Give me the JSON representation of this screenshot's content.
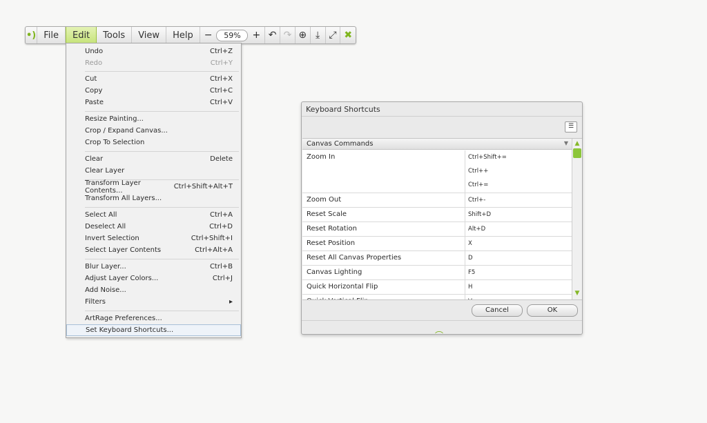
{
  "toolbar": {
    "menus": [
      "File",
      "Edit",
      "Tools",
      "View",
      "Help"
    ],
    "zoom_value": "59%",
    "zoom_minus": "−",
    "zoom_plus": "+",
    "icons": [
      "app-logo-icon",
      "undo-icon",
      "redo-icon",
      "add-canvas-icon",
      "download-icon",
      "fullscreen-icon",
      "close-icon"
    ]
  },
  "edit_menu": {
    "items": [
      {
        "label": "Undo",
        "shortcut": "Ctrl+Z"
      },
      {
        "label": "Redo",
        "shortcut": "Ctrl+Y",
        "disabled": true
      },
      {
        "label": "Cut",
        "shortcut": "Ctrl+X"
      },
      {
        "label": "Copy",
        "shortcut": "Ctrl+C"
      },
      {
        "label": "Paste",
        "shortcut": "Ctrl+V"
      },
      {
        "label": "Resize Painting...",
        "shortcut": ""
      },
      {
        "label": "Crop / Expand Canvas...",
        "shortcut": ""
      },
      {
        "label": "Crop To Selection",
        "shortcut": ""
      },
      {
        "label": "Clear",
        "shortcut": "Delete"
      },
      {
        "label": "Clear Layer",
        "shortcut": ""
      },
      {
        "label": "Transform Layer Contents...",
        "shortcut": "Ctrl+Shift+Alt+T"
      },
      {
        "label": "Transform All Layers...",
        "shortcut": ""
      },
      {
        "label": "Select All",
        "shortcut": "Ctrl+A"
      },
      {
        "label": "Deselect All",
        "shortcut": "Ctrl+D"
      },
      {
        "label": "Invert Selection",
        "shortcut": "Ctrl+Shift+I"
      },
      {
        "label": "Select Layer Contents",
        "shortcut": "Ctrl+Alt+A"
      },
      {
        "label": "Blur Layer...",
        "shortcut": "Ctrl+B"
      },
      {
        "label": "Adjust Layer Colors...",
        "shortcut": "Ctrl+J"
      },
      {
        "label": "Add Noise...",
        "shortcut": ""
      },
      {
        "label": "Filters",
        "shortcut": "▸"
      },
      {
        "label": "ArtRage Preferences...",
        "shortcut": ""
      },
      {
        "label": "Set Keyboard Shortcuts...",
        "shortcut": "",
        "highlighted": true
      }
    ]
  },
  "dialog": {
    "title": "Keyboard Shortcuts",
    "group_label": "Canvas Commands",
    "commands": [
      {
        "name": "Zoom In",
        "keys": [
          "Ctrl+Shift+=",
          "Ctrl++",
          "Ctrl+="
        ]
      },
      {
        "name": "Zoom Out",
        "keys": [
          "Ctrl+-"
        ]
      },
      {
        "name": "Reset Scale",
        "keys": [
          "Shift+D"
        ]
      },
      {
        "name": "Reset Rotation",
        "keys": [
          "Alt+D"
        ]
      },
      {
        "name": "Reset Position",
        "keys": [
          "X"
        ]
      },
      {
        "name": "Reset All Canvas Properties",
        "keys": [
          "D"
        ]
      },
      {
        "name": "Canvas Lighting",
        "keys": [
          "F5"
        ]
      },
      {
        "name": "Quick Horizontal Flip",
        "keys": [
          "H"
        ]
      },
      {
        "name": "Quick Vertical Flip",
        "keys": [
          "V"
        ]
      }
    ],
    "cancel_label": "Cancel",
    "ok_label": "OK"
  },
  "colors": {
    "accent": "#8cc63a",
    "menu_active": "#c6e37a"
  }
}
